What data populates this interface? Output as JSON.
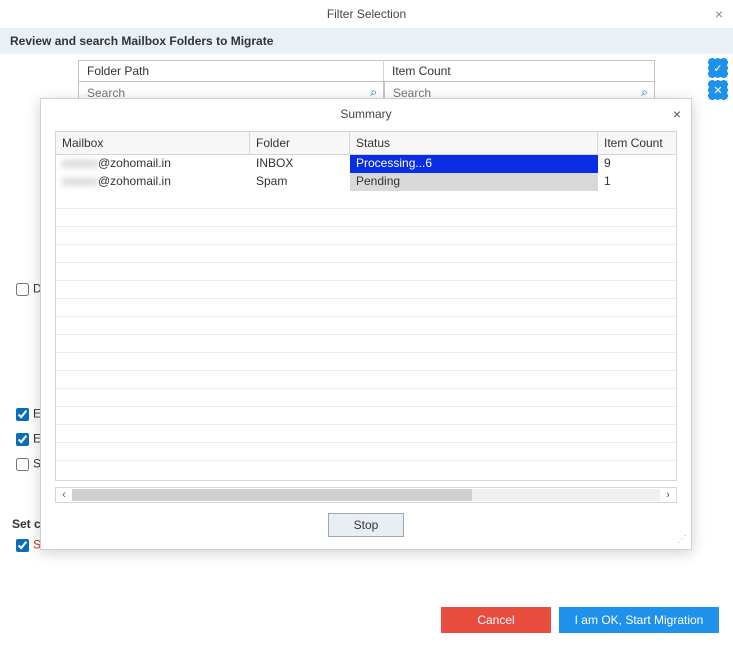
{
  "main": {
    "title": "Filter Selection",
    "subtitle": "Review and search Mailbox Folders to Migrate",
    "columns": {
      "folder": "Folder Path",
      "count": "Item Count"
    },
    "search_placeholder": "Search",
    "option_d": "D",
    "option_e1": "E",
    "option_e2": "E",
    "option_s": "S",
    "set_label": "Set c",
    "s_label": "S",
    "cancel": "Cancel",
    "start": "I am OK, Start Migration"
  },
  "modal": {
    "title": "Summary",
    "columns": {
      "mailbox": "Mailbox",
      "folder": "Folder",
      "status": "Status",
      "count": "Item Count"
    },
    "rows": [
      {
        "mailbox_hidden": "xxxxxx",
        "mailbox_domain": "@zohomail.in",
        "folder": "INBOX",
        "status": "Processing...6",
        "status_class": "status-processing",
        "count": "9"
      },
      {
        "mailbox_hidden": "xxxxxx",
        "mailbox_domain": "@zohomail.in",
        "folder": "Spam",
        "status": "Pending",
        "status_class": "status-pending",
        "count": "1"
      }
    ],
    "stop": "Stop"
  }
}
